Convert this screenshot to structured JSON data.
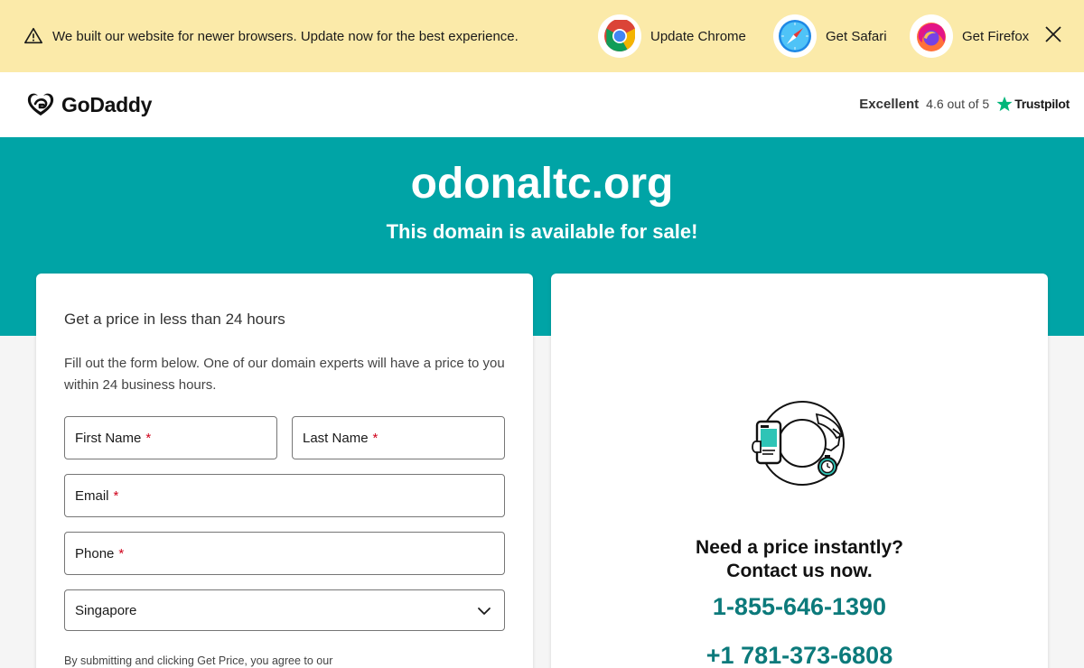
{
  "banner": {
    "message": "We built our website for newer browsers. Update now for the best experience.",
    "chrome_label": "Update Chrome",
    "safari_label": "Get Safari",
    "firefox_label": "Get Firefox"
  },
  "header": {
    "logo_text": "GoDaddy",
    "trust_label": "Excellent",
    "trust_rating": "4.6 out of 5",
    "trust_brand": "Trustpilot"
  },
  "hero": {
    "domain": "odonaltc.org",
    "subtitle": "This domain is available for sale!"
  },
  "form": {
    "title": "Get a price in less than 24 hours",
    "description": "Fill out the form below. One of our domain experts will have a price to you within 24 business hours.",
    "first_name_label": "First Name",
    "last_name_label": "Last Name",
    "email_label": "Email",
    "phone_label": "Phone",
    "required_mark": "*",
    "country_value": "Singapore",
    "disclaimer": "By submitting and clicking Get Price, you agree to our"
  },
  "contact": {
    "question_line1": "Need a price instantly?",
    "question_line2": "Contact us now.",
    "phone_1": "1-855-646-1390",
    "phone_2": "+1 781-373-6808"
  },
  "colors": {
    "banner_bg": "#fbeaa9",
    "hero_bg": "#00a4a6",
    "phone_link": "#0c7a7b",
    "required": "#d0021b",
    "trustpilot_star": "#00b67a"
  }
}
